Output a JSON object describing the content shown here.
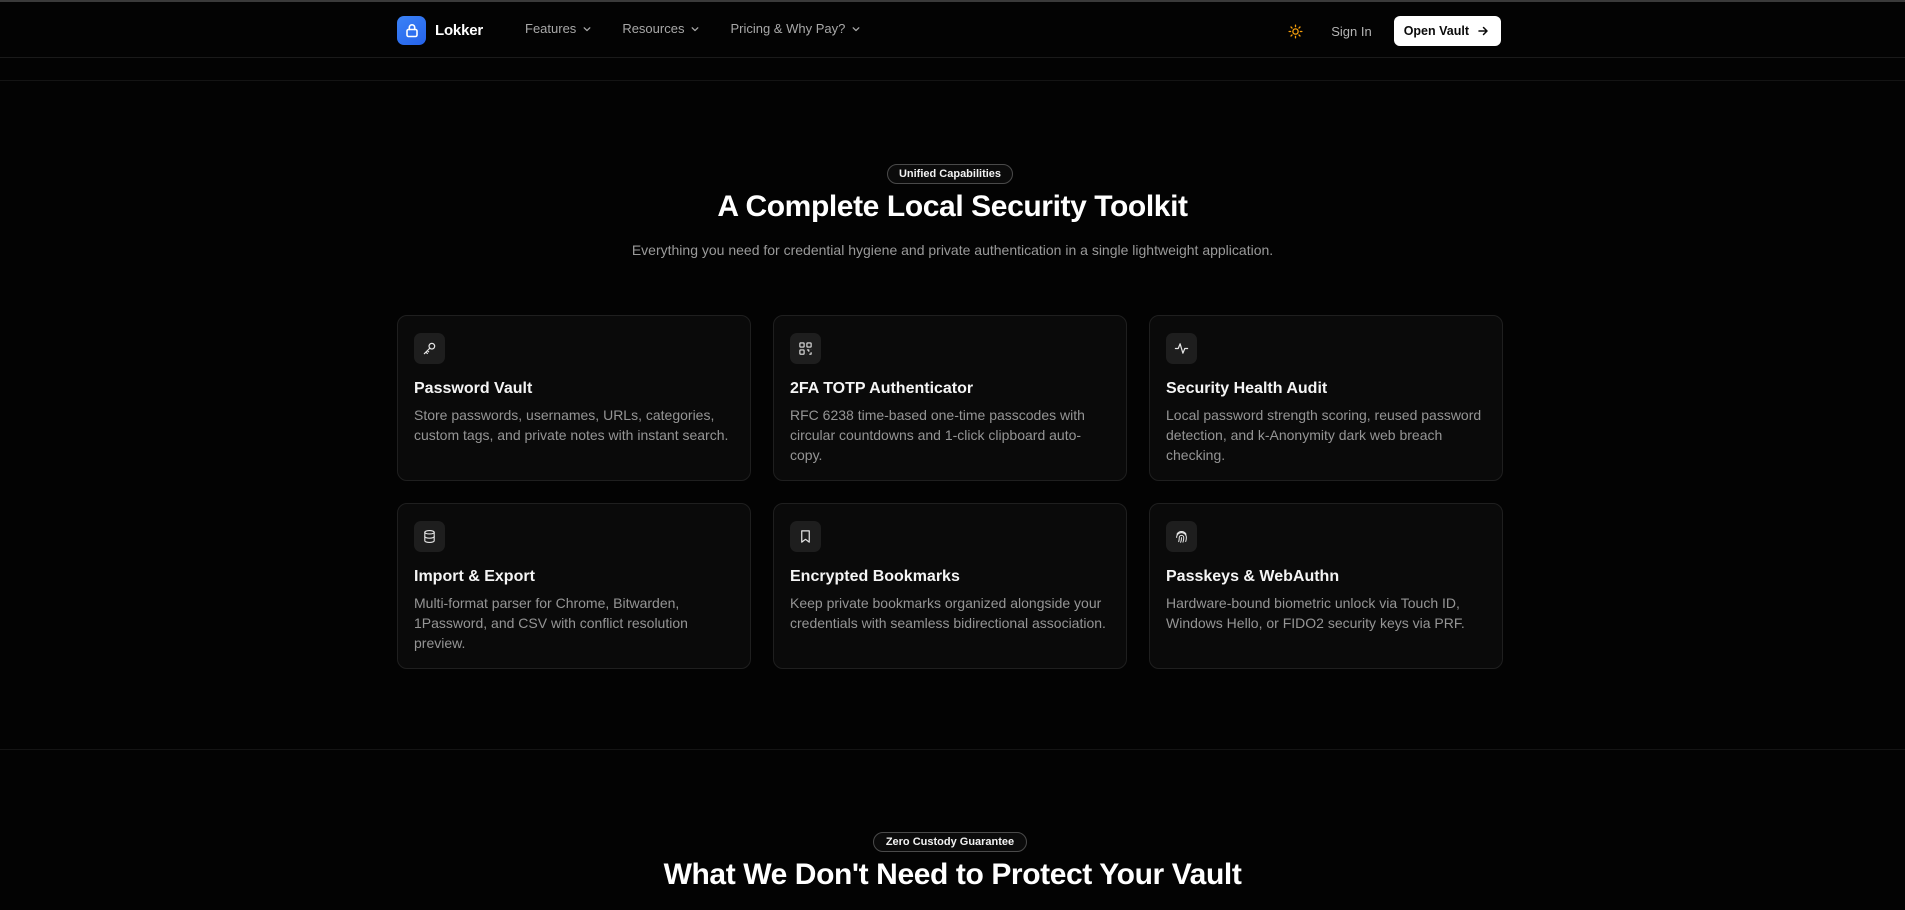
{
  "nav": {
    "brand": "Lokker",
    "links": [
      {
        "label": "Features"
      },
      {
        "label": "Resources"
      },
      {
        "label": "Pricing & Why Pay?"
      }
    ],
    "signin_label": "Sign In",
    "cta_label": "Open Vault"
  },
  "capabilities": {
    "badge": "Unified Capabilities",
    "title": "A Complete Local Security Toolkit",
    "subtitle": "Everything you need for credential hygiene and private authentication in a single lightweight application.",
    "cards": [
      {
        "icon": "key-icon",
        "title": "Password Vault",
        "desc": "Store passwords, usernames, URLs, categories, custom tags, and private notes with instant search."
      },
      {
        "icon": "qr-code-icon",
        "title": "2FA TOTP Authenticator",
        "desc": "RFC 6238 time-based one-time passcodes with circular countdowns and 1-click clipboard auto-copy."
      },
      {
        "icon": "activity-icon",
        "title": "Security Health Audit",
        "desc": "Local password strength scoring, reused password detection, and k-Anonymity dark web breach checking."
      },
      {
        "icon": "database-icon",
        "title": "Import & Export",
        "desc": "Multi-format parser for Chrome, Bitwarden, 1Password, and CSV with conflict resolution preview."
      },
      {
        "icon": "bookmark-icon",
        "title": "Encrypted Bookmarks",
        "desc": "Keep private bookmarks organized alongside your credentials with seamless bidirectional association."
      },
      {
        "icon": "fingerprint-icon",
        "title": "Passkeys & WebAuthn",
        "desc": "Hardware-bound biometric unlock via Touch ID, Windows Hello, or FIDO2 security keys via PRF."
      }
    ]
  },
  "custody": {
    "badge": "Zero Custody Guarantee",
    "title": "What We Don't Need to Protect Your Vault"
  },
  "colors": {
    "background": "#030303",
    "brand_accent": "#2563eb",
    "theme_icon": "#f59e0b",
    "cta_bg": "#ffffff"
  }
}
